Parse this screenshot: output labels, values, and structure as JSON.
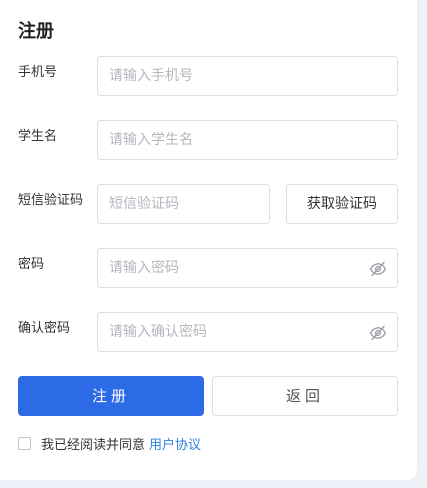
{
  "form": {
    "title": "注册",
    "phone": {
      "label": "手机号",
      "placeholder": "请输入手机号",
      "value": ""
    },
    "student_name": {
      "label": "学生名",
      "placeholder": "请输入学生名",
      "value": ""
    },
    "sms_code": {
      "label": "短信验证码",
      "placeholder": "短信验证码",
      "value": "",
      "get_code_label": "获取验证码"
    },
    "password": {
      "label": "密码",
      "placeholder": "请输入密码",
      "value": "",
      "toggle_icon": "eye-hidden-icon"
    },
    "confirm_password": {
      "label": "确认密码",
      "placeholder": "请输入确认密码",
      "value": "",
      "toggle_icon": "eye-hidden-icon"
    },
    "register_label": "注册",
    "back_label": "返回",
    "agree_text": "我已经阅读并同意",
    "agreement_link": "用户协议"
  },
  "colors": {
    "primary": "#2d6ae6",
    "link": "#2d7fe0",
    "border": "#dcdfe6",
    "placeholder": "#b4b7be",
    "page_background": "#eef0f7"
  }
}
